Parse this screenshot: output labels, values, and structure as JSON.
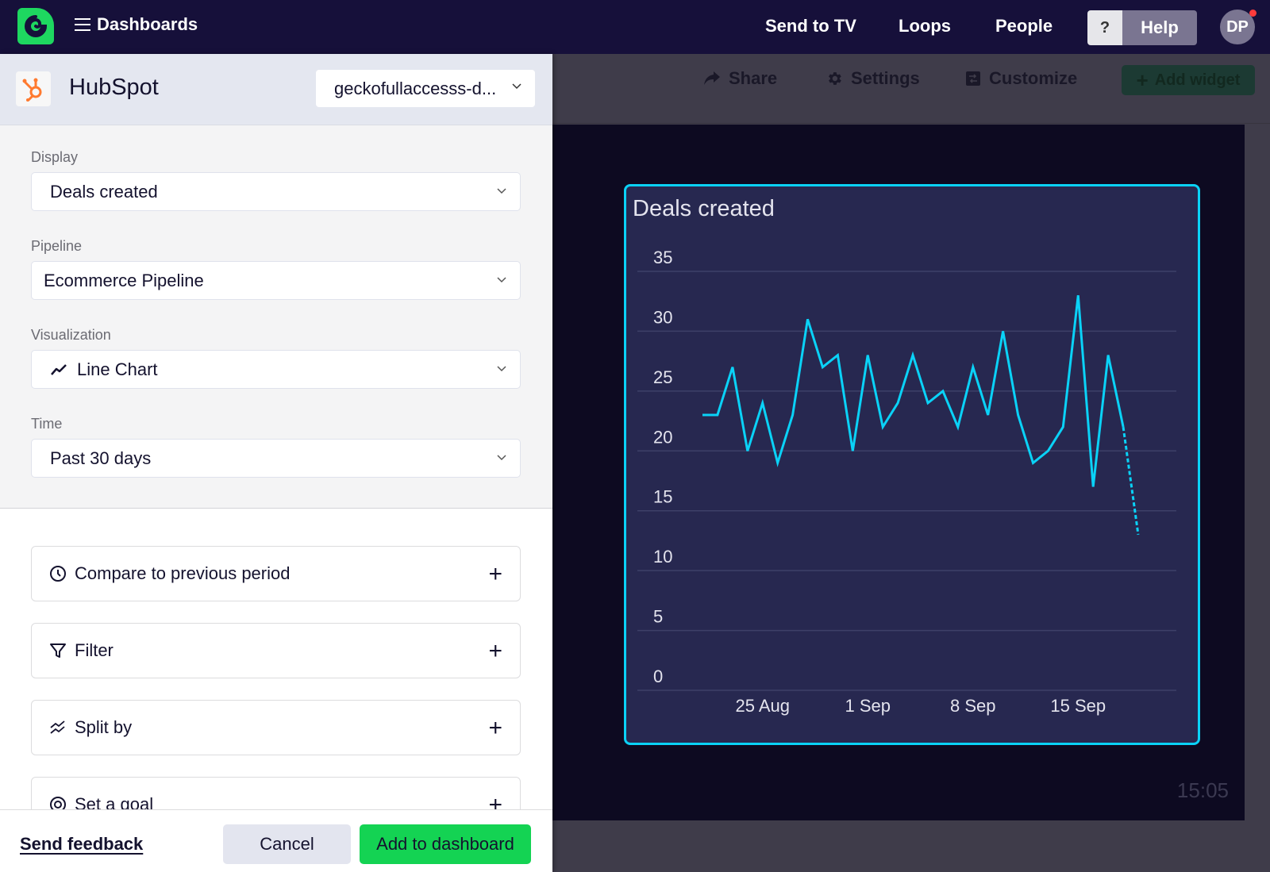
{
  "topbar": {
    "menu_label": "Dashboards",
    "nav": [
      "Send to TV",
      "Loops",
      "People"
    ],
    "help_q": "?",
    "help_label": "Help",
    "avatar_initials": "DP"
  },
  "dashboard_toolbar": {
    "share": "Share",
    "settings": "Settings",
    "customize": "Customize",
    "add_widget": "Add widget"
  },
  "panel": {
    "integration": "HubSpot",
    "account": "geckofullaccesss-d...",
    "fields": [
      {
        "label": "Display",
        "value": "Deals created"
      },
      {
        "label": "Pipeline",
        "value": "Ecommerce Pipeline"
      },
      {
        "label": "Visualization",
        "value": "Line Chart"
      },
      {
        "label": "Time",
        "value": "Past 30 days"
      }
    ],
    "options": [
      "Compare to previous period",
      "Filter",
      "Split by",
      "Set a goal"
    ],
    "footer": {
      "feedback": "Send feedback",
      "cancel": "Cancel",
      "add": "Add to dashboard"
    }
  },
  "clock": "15:05",
  "colors": {
    "accent": "#0ad2f7",
    "brand_green": "#1ed760",
    "button_green": "#14d353",
    "hubspot_orange": "#ff7a2f"
  },
  "chart_data": {
    "type": "line",
    "title": "Deals created",
    "xlabel": "",
    "ylabel": "",
    "ylim": [
      0,
      35
    ],
    "yticks": [
      0,
      5,
      10,
      15,
      20,
      25,
      30,
      35
    ],
    "x": [
      "21 Aug",
      "22 Aug",
      "23 Aug",
      "24 Aug",
      "25 Aug",
      "26 Aug",
      "27 Aug",
      "28 Aug",
      "29 Aug",
      "30 Aug",
      "31 Aug",
      "1 Sep",
      "2 Sep",
      "3 Sep",
      "4 Sep",
      "5 Sep",
      "6 Sep",
      "7 Sep",
      "8 Sep",
      "9 Sep",
      "10 Sep",
      "11 Sep",
      "12 Sep",
      "13 Sep",
      "14 Sep",
      "15 Sep",
      "16 Sep",
      "17 Sep",
      "18 Sep",
      "19 Sep",
      "20 Sep"
    ],
    "xticks": [
      {
        "label": "25 Aug",
        "index": 4
      },
      {
        "label": "1 Sep",
        "index": 11
      },
      {
        "label": "8 Sep",
        "index": 18
      },
      {
        "label": "15 Sep",
        "index": 25
      }
    ],
    "series": [
      {
        "name": "Deals created",
        "values": [
          23,
          23,
          27,
          20,
          24,
          19,
          23,
          31,
          27,
          28,
          20,
          28,
          22,
          24,
          28,
          24,
          25,
          22,
          27,
          23,
          30,
          23,
          19,
          20,
          22,
          33,
          17,
          28,
          22,
          13
        ],
        "last_segment_dashed": true
      }
    ],
    "grid": true,
    "legend": "none"
  }
}
